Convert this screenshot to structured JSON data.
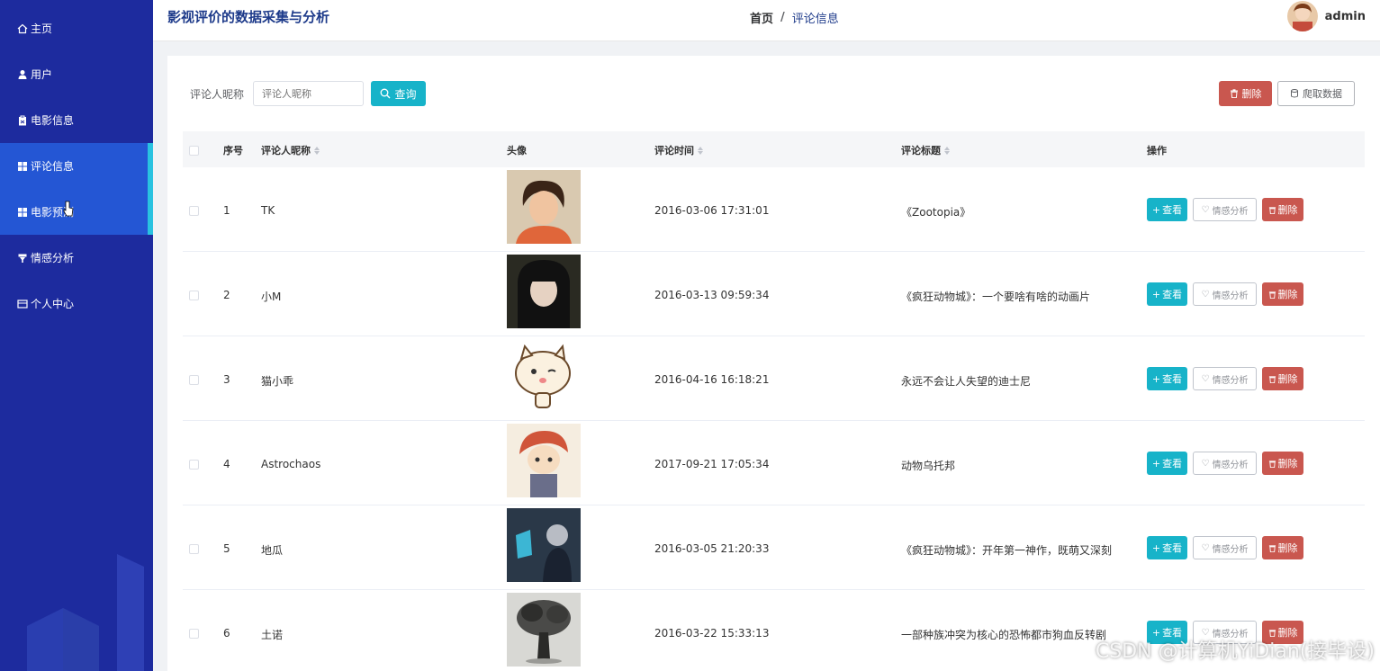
{
  "app": {
    "title": "影视评价的数据采集与分析"
  },
  "breadcrumb": {
    "home": "首页",
    "separator": "/",
    "current": "评论信息"
  },
  "user": {
    "name": "admin"
  },
  "sidebar": {
    "items": [
      {
        "label": "主页",
        "icon": "home-icon"
      },
      {
        "label": "用户",
        "icon": "user-icon"
      },
      {
        "label": "电影信息",
        "icon": "clipboard-icon"
      },
      {
        "label": "评论信息",
        "icon": "grid-icon",
        "active": true
      },
      {
        "label": "电影预测",
        "icon": "grid-icon"
      },
      {
        "label": "情感分析",
        "icon": "filter-icon"
      },
      {
        "label": "个人中心",
        "icon": "card-icon"
      }
    ]
  },
  "search": {
    "label": "评论人昵称",
    "placeholder": "评论人昵称",
    "button": "查询"
  },
  "toolbar": {
    "delete": "删除",
    "crawl": "爬取数据"
  },
  "table": {
    "headers": {
      "index": "序号",
      "nickname": "评论人昵称",
      "avatar": "头像",
      "time": "评论时间",
      "title": "评论标题",
      "ops": "操作"
    },
    "ops": {
      "view": "查看",
      "emotion": "情感分析",
      "delete": "删除"
    },
    "rows": [
      {
        "index": "1",
        "nickname": "TK",
        "time": "2016-03-06 17:31:01",
        "title": "《Zootopia》"
      },
      {
        "index": "2",
        "nickname": "小M",
        "time": "2016-03-13 09:59:34",
        "title": "《疯狂动物城》：一个要啥有啥的动画片"
      },
      {
        "index": "3",
        "nickname": "猫小乖",
        "time": "2016-04-16 16:18:21",
        "title": "永远不会让人失望的迪士尼"
      },
      {
        "index": "4",
        "nickname": "Astrochaos",
        "time": "2017-09-21 17:05:34",
        "title": "动物乌托邦"
      },
      {
        "index": "5",
        "nickname": "地瓜",
        "time": "2016-03-05 21:20:33",
        "title": "《疯狂动物城》：开年第一神作，既萌又深刻"
      },
      {
        "index": "6",
        "nickname": "土诺",
        "time": "2016-03-22 15:33:13",
        "title": "一部种族冲突为核心的恐怖都市狗血反转剧"
      }
    ]
  },
  "watermark": "CSDN @计算机YiDian(接毕设)",
  "colors": {
    "sidebar": "#1d2b9e",
    "active": "#2456d4",
    "accent": "#17b3c9",
    "danger": "#c9574f"
  }
}
